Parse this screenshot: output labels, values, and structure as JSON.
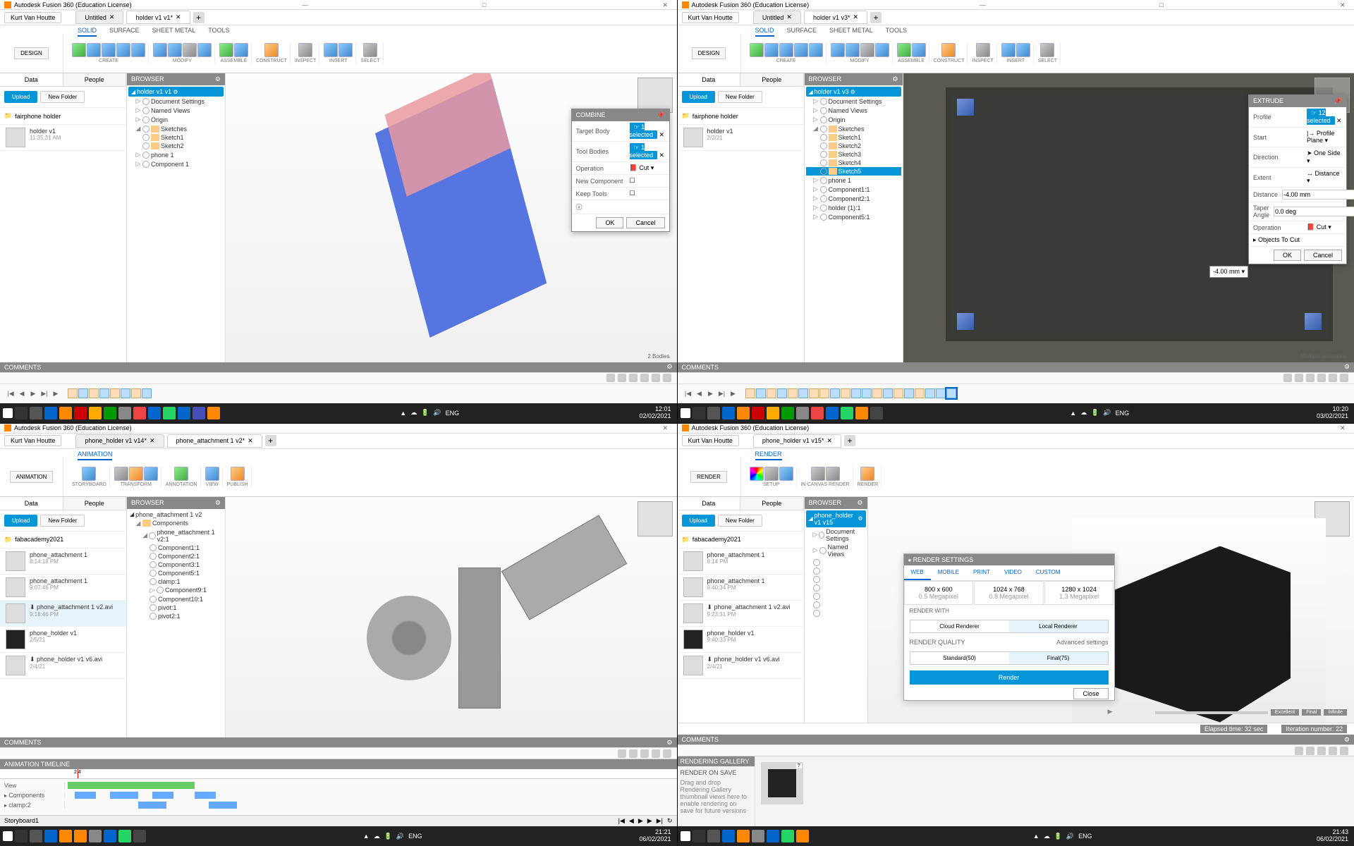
{
  "app_title": "Autodesk Fusion 360 (Education License)",
  "user": "Kurt Van Houtte",
  "tabs_q1": {
    "untitled": "Untitled",
    "active": "holder v1 v1*"
  },
  "tabs_q2": {
    "untitled": "Untitled",
    "active": "holder v1 v3*"
  },
  "tabs_q3": {
    "a": "phone_holder v1 v14*",
    "active": "phone_attachment 1 v2*"
  },
  "tabs_q4": {
    "active": "phone_holder v1 v15*"
  },
  "workspace": {
    "design": "DESIGN",
    "animation": "ANIMATION",
    "render": "RENDER"
  },
  "ribbontabs": {
    "solid": "SOLID",
    "surface": "SURFACE",
    "sheet": "SHEET METAL",
    "tools": "TOOLS"
  },
  "ribbongroups": {
    "create": "CREATE",
    "modify": "MODIFY",
    "assemble": "ASSEMBLE",
    "construct": "CONSTRUCT",
    "inspect": "INSPECT",
    "insert": "INSERT",
    "select": "SELECT",
    "transform": "TRANSFORM",
    "annotation": "ANNOTATION",
    "view": "VIEW",
    "publish": "PUBLISH",
    "storyboard": "STORYBOARD",
    "setup": "SETUP",
    "incanvas": "IN-CANVAS RENDER"
  },
  "leftpanel": {
    "data": "Data",
    "people": "People",
    "upload": "Upload",
    "newfolder": "New Folder"
  },
  "folder_q1": {
    "name": "fairphone holder",
    "items": [
      {
        "name": "holder v1",
        "date": "11:35:31 AM"
      }
    ]
  },
  "folder_q2": {
    "name": "fairphone holder",
    "items": [
      {
        "name": "holder v1",
        "date": "2/2/21"
      }
    ]
  },
  "folder_q3": {
    "name": "fabacademy2021",
    "items": [
      {
        "name": "phone_attachment 1",
        "date": "8:14:18 PM"
      },
      {
        "name": "phone_attachment 1",
        "date": "9:07:46 PM"
      },
      {
        "name": "⬇ phone_attachment 1 v2.avi",
        "date": "9:18:46 PM"
      },
      {
        "name": "phone_holder v1",
        "date": "2/5/21"
      },
      {
        "name": "⬇ phone_holder v1 v6.avi",
        "date": "2/4/21"
      }
    ]
  },
  "folder_q4": {
    "name": "fabacademy2021",
    "items": [
      {
        "name": "phone_attachment 1",
        "date": "8:14 PM"
      },
      {
        "name": "phone_attachment 1",
        "date": "9:40:34 PM"
      },
      {
        "name": "⬇ phone_attachment 1 v2.avi",
        "date": "9:23:31 PM"
      },
      {
        "name": "phone_holder v1",
        "date": "9:40:33 PM"
      },
      {
        "name": "⬇ phone_holder v1 v6.avi",
        "date": "2/4/21"
      }
    ]
  },
  "browser": {
    "header": "BROWSER",
    "root_q1": "holder v1 v1",
    "root_q2": "holder v1 v3",
    "root_q3": "phone_attachment 1 v2",
    "root_q4": "phone_holder v1 v15",
    "nodes_q1": [
      "Document Settings",
      "Named Views",
      "Origin",
      "Sketches",
      "Sketch1",
      "Sketch2",
      "phone 1",
      "Component 1"
    ],
    "nodes_q2": [
      "Document Settings",
      "Named Views",
      "Origin",
      "Sketches",
      "Sketch1",
      "Sketch2",
      "Sketch3",
      "Sketch4",
      "Sketch5",
      "phone 1",
      "Component1:1",
      "Component2:1",
      "holder (1):1",
      "Component5:1"
    ],
    "nodes_q3": [
      "Components",
      "phone_attachment 1 v2:1",
      "Component1:1",
      "Component2:1",
      "Component3:1",
      "Component5:1",
      "clamp:1",
      "Component9:1",
      "Component10:1",
      "pivot:1",
      "pivot2:1"
    ],
    "nodes_q4": [
      "Document Settings",
      "Named Views"
    ]
  },
  "comments": "COMMENTS",
  "combine_dialog": {
    "title": "COMBINE",
    "target": "Target Body",
    "target_val": "1 selected",
    "tool": "Tool Bodies",
    "tool_val": "1 selected",
    "operation": "Operation",
    "op_val": "Cut",
    "newcomp": "New Component",
    "keeptools": "Keep Tools",
    "ok": "OK",
    "cancel": "Cancel"
  },
  "extrude_dialog": {
    "title": "EXTRUDE",
    "profile": "Profile",
    "profile_val": "12 selected",
    "start": "Start",
    "start_val": "Profile Plane",
    "direction": "Direction",
    "dir_val": "One Side",
    "extent": "Extent",
    "ext_val": "Distance",
    "distance": "Distance",
    "dist_val": "-4.00 mm",
    "taper": "Taper Angle",
    "taper_val": "0.0 deg",
    "operation": "Operation",
    "op_val": "Cut",
    "objects": "Objects To Cut",
    "ok": "OK",
    "cancel": "Cancel",
    "floatval": "-4.00 mm"
  },
  "status_q1": "2 Bodies",
  "status_q2": "Multiple selections",
  "render_settings": {
    "hdr": "RENDER SETTINGS",
    "web": "WEB",
    "mobile": "MOBILE",
    "print": "PRINT",
    "video": "VIDEO",
    "custom": "CUSTOM",
    "res": [
      {
        "w": "800 x 600",
        "mp": "0.5 Megapixel"
      },
      {
        "w": "1024 x 768",
        "mp": "0.8 Megapixel"
      },
      {
        "w": "1280 x 1024",
        "mp": "1.3 Megapixel"
      }
    ],
    "renderwith": "RENDER WITH",
    "cloud": "Cloud Renderer",
    "local": "Local Renderer",
    "quality": "RENDER QUALITY",
    "advanced": "Advanced settings",
    "standard": "Standard(50)",
    "final": "Final(75)",
    "render": "Render",
    "close": "Close"
  },
  "render_gallery": {
    "hdr": "RENDERING GALLERY",
    "onsave": "RENDER ON SAVE",
    "hint": "Drag and drop Rendering Gallery thumbnail views here to enable rendering on save for future versions",
    "pct": "?"
  },
  "render_status": {
    "elapsed": "Elapsed time: 32 sec",
    "iter": "Iteration number: 22",
    "excellent": "Excellent",
    "final": "Final",
    "infinite": "Infinite"
  },
  "anim_timeline": {
    "hdr": "ANIMATION TIMELINE",
    "storyboard": "Storyboard1",
    "view": "View",
    "components": "Components",
    "clamp": "clamp:2",
    "pos": "2.4"
  },
  "clocks": {
    "q1": {
      "time": "12:01",
      "date": "02/02/2021"
    },
    "q2": {
      "time": "10:20",
      "date": "03/02/2021"
    },
    "q3": {
      "time": "21:21",
      "date": "06/02/2021"
    },
    "q4": {
      "time": "21:43",
      "date": "06/02/2021"
    }
  },
  "tray": "ENG"
}
